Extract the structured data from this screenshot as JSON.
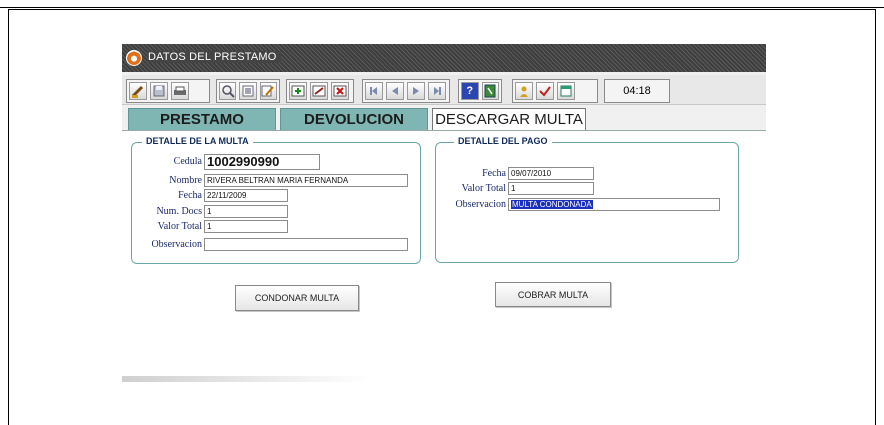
{
  "window": {
    "title": "DATOS DEL PRESTAMO"
  },
  "toolbar": {
    "icons": [
      "clear-icon",
      "save-icon",
      "print-icon",
      "find-icon",
      "list-icon",
      "edit-icon",
      "insert-record-icon",
      "modify-record-icon",
      "delete-record-icon",
      "first-record-icon",
      "prev-record-icon",
      "next-record-icon",
      "last-record-icon",
      "help-icon",
      "exit-icon",
      "user-icon",
      "check-icon",
      "calendar-icon"
    ],
    "clock": "04:18"
  },
  "tabs": [
    {
      "label": "PRESTAMO"
    },
    {
      "label": "DEVOLUCION"
    },
    {
      "label": "DESCARGAR MULTA"
    }
  ],
  "detalle_multa": {
    "title": "DETALLE DE LA MULTA",
    "cedula_label": "Cedula",
    "cedula": "1002990990",
    "nombre_label": "Nombre",
    "nombre": "RIVERA BELTRAN MARIA FERNANDA",
    "fecha_label": "Fecha",
    "fecha": "22/11/2009",
    "num_docs_label": "Num. Docs",
    "num_docs": "1",
    "valor_total_label": "Valor Total",
    "valor_total": "1",
    "observacion_label": "Observacion",
    "observacion": ""
  },
  "detalle_pago": {
    "title": "DETALLE DEL PAGO",
    "fecha_label": "Fecha",
    "fecha": "09/07/2010",
    "valor_total_label": "Valor Total",
    "valor_total": "1",
    "observacion_label": "Observacion",
    "observacion": "MULTA CONDONADA"
  },
  "buttons": {
    "condonar": "CONDONAR MULTA",
    "cobrar": "COBRAR MULTA"
  }
}
